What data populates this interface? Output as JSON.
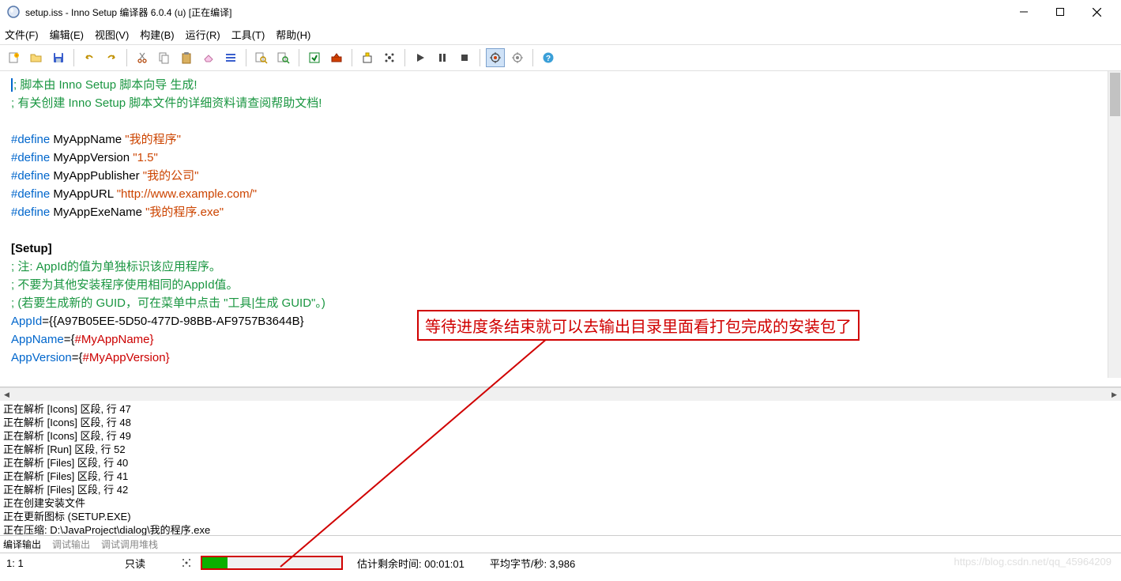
{
  "window": {
    "title": "setup.iss - Inno Setup 编译器 6.0.4 (u)  [正在编译]"
  },
  "menu": {
    "file": "文件(F)",
    "edit": "编辑(E)",
    "view": "视图(V)",
    "build": "构建(B)",
    "run": "运行(R)",
    "tools": "工具(T)",
    "help": "帮助(H)"
  },
  "editor": {
    "l1": "; 脚本由 Inno Setup 脚本向导 生成!",
    "l2": "; 有关创建 Inno Setup 脚本文件的详细资料请查阅帮助文档!",
    "l3_def": "#define",
    "l3_name": " MyAppName ",
    "l3_val": "\"我的程序\"",
    "l4_name": " MyAppVersion ",
    "l4_val": "\"1.5\"",
    "l5_name": " MyAppPublisher ",
    "l5_val": "\"我的公司\"",
    "l6_name": " MyAppURL ",
    "l6_val": "\"http://www.example.com/\"",
    "l7_name": " MyAppExeName ",
    "l7_val": "\"我的程序.exe\"",
    "section": "[Setup]",
    "c1": "; 注: AppId的值为单独标识该应用程序。",
    "c2": "; 不要为其他安装程序使用相同的AppId值。",
    "c3": "; (若要生成新的 GUID，可在菜单中点击 \"工具|生成 GUID\"。)",
    "appid_k": "AppId",
    "appid_v": "={{A97B05EE-5D50-477D-98BB-AF9757B3644B}",
    "appname_k": "AppName",
    "appname_eq": "={",
    "appname_v": "#MyAppName",
    "brace": "}",
    "appver_k": "AppVersion",
    "appver_v": "#MyAppVersion"
  },
  "output": {
    "l1": "正在解析 [Icons] 区段, 行 47",
    "l2": "正在解析 [Icons] 区段, 行 48",
    "l3": "正在解析 [Icons] 区段, 行 49",
    "l4": "正在解析 [Run] 区段, 行 52",
    "l5": "正在解析 [Files] 区段, 行 40",
    "l6": "正在解析 [Files] 区段, 行 41",
    "l7": "正在解析 [Files] 区段, 行 42",
    "l8": "正在创建安装文件",
    "l9": "   正在更新图标 (SETUP.EXE)",
    "l10": "   正在压缩: D:\\JavaProject\\dialog\\我的程序.exe"
  },
  "tabs": {
    "compile_output": "编译输出",
    "debug_output": "调试输出",
    "debug_callstack": "调试调用堆栈"
  },
  "status": {
    "cursor": "1:   1",
    "readonly": "只读",
    "time_left": "估计剩余时间: 00:01:01",
    "avg_bytes": "平均字节/秒: 3,986"
  },
  "annotation": "等待进度条结束就可以去输出目录里面看打包完成的安装包了",
  "watermark": "https://blog.csdn.net/qq_45964209"
}
